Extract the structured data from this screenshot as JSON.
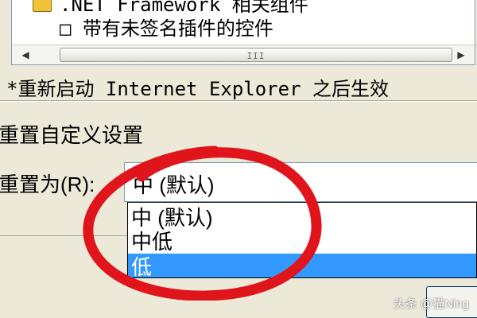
{
  "components_list": {
    "rows": [
      {
        "icon": "checkbox-icon",
        "label": ".NET Framework 相关组件"
      },
      {
        "icon": "checkbox-icon",
        "label": "□ 带有未签名插件的控件"
      }
    ],
    "scrollbar_grip": "III"
  },
  "restart_note": "*重新启动 Internet Explorer 之后生效",
  "reset_group": {
    "title": "重置自定义设置",
    "reset_to_label": "重置为(R):",
    "selected_value": "中 (默认)",
    "options": [
      "中 (默认)",
      "中低",
      "低"
    ],
    "highlighted_option": "低"
  },
  "annotation": {
    "color": "#e0141b"
  },
  "watermark": "头条 @猫Ning",
  "colors": {
    "highlight": "#3399ff",
    "window_bg": "#ece9d8"
  }
}
